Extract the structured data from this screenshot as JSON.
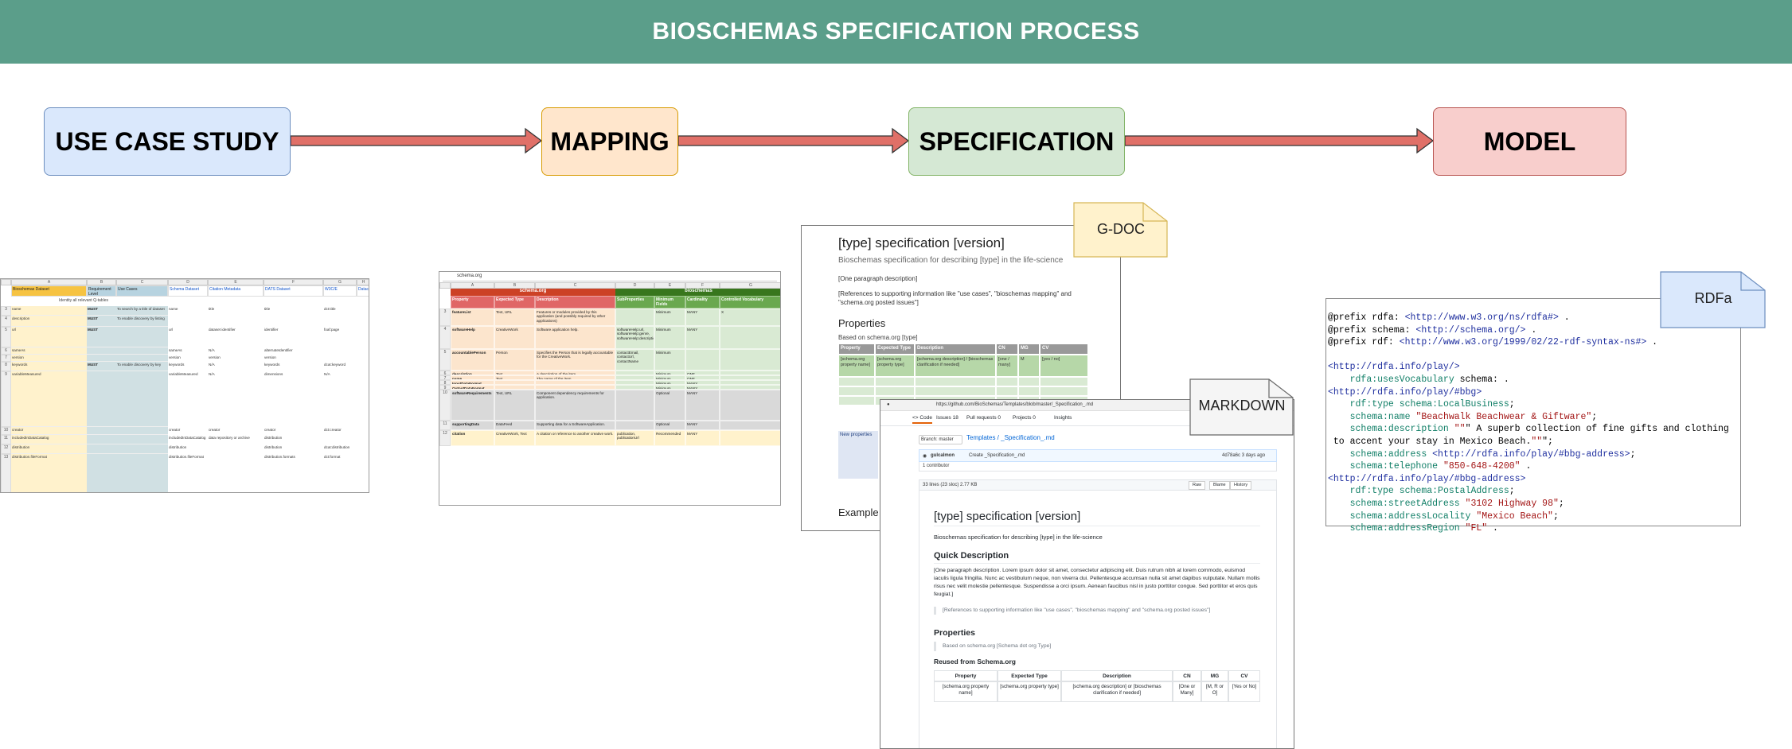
{
  "banner": {
    "title": "BIOSCHEMAS SPECIFICATION PROCESS"
  },
  "stages": [
    {
      "label": "USE CASE STUDY"
    },
    {
      "label": "MAPPING"
    },
    {
      "label": "SPECIFICATION"
    },
    {
      "label": "MODEL"
    }
  ],
  "colors": {
    "banner": "#5b9e8a",
    "arrow_fill": "#e07068",
    "arrow_stroke": "#333333"
  },
  "notes": {
    "gdoc": "G-DOC",
    "markdown": "MARKDOWN",
    "rdfa": "RDFa"
  },
  "gdoc": {
    "title": "[type] specification [version]",
    "subtitle": "Bioschemas specification for describing [type] in the life-science",
    "para1": "[One paragraph description]",
    "para2": "[References to supporting information like \"use cases\", \"bioschemas mapping\" and \"schema.org posted issues\"]",
    "properties_heading": "Properties",
    "based_on": "Based on schema.org [type]",
    "table_headers": [
      "Property",
      "Expected Type",
      "Description",
      "CN",
      "MG",
      "CV"
    ],
    "table_row": [
      "[schema.org property name]",
      "[schema.org property type]",
      "[schema.org description] / [bioschemas clarification if needed]",
      "[one / many]",
      "M",
      "[yes / no]"
    ],
    "new_props": "New properties",
    "example": "Example"
  },
  "github": {
    "url": "https://github.com/BioSchemas/Templates/blob/master/_Specification_.md",
    "tabs": [
      "<> Code",
      "Issues 18",
      "Pull requests 0",
      "Projects 0",
      "Insights"
    ],
    "branch": "Branch: master",
    "breadcrumb": "Templates / _Specification_.md",
    "author": "gulcalmon",
    "commit": "Create _Specification_.md",
    "commit_meta": "4d78a6c 3 days ago",
    "contributors": "1 contributor",
    "file_meta": "33 lines (23 sloc)  2.77 KB",
    "file_buttons": [
      "Raw",
      "Blame",
      "History"
    ],
    "h1": "[type] specification [version]",
    "sub": "Bioschemas specification for describing [type] in the life-science",
    "quick": "Quick Description",
    "desc": "[One paragraph description. Lorem ipsum dolor sit amet, consectetur adipiscing elit. Duis rutrum nibh at lorem commodo, euismod iaculis ligula fringilla. Nunc ac vestibulum neque, non viverra dui. Pellentesque accumsan nulla sit amet dapibus vulputate. Nullam mollis risus nec velit molestie pellentesque. Suspendisse a orci ipsum. Aenean faucibus nisl in justo porttitor congue. Sed porttitor et eros quis feugiat.]",
    "refs": "[References to supporting information like \"use cases\", \"bioschemas mapping\" and \"schema.org posted issues\"]",
    "props": "Properties",
    "based": "Based on schema.org [Schema dot org Type]",
    "reused": "Reused from Schema.org",
    "table_headers": [
      "Property",
      "Expected Type",
      "Description",
      "CN",
      "MG",
      "CV"
    ],
    "table_row": [
      "[schema.org property name]",
      "[schema.org property type]",
      "[schema.org description] or [bioschemas clarification if needed]",
      "[One or Many]",
      "[M, R or O]",
      "[Yes or No]"
    ]
  },
  "rdfa": {
    "lines": [
      "@prefix rdfa: <http://www.w3.org/ns/rdfa#> .",
      "@prefix schema: <http://schema.org/> .",
      "@prefix rdf: <http://www.w3.org/1999/02/22-rdf-syntax-ns#> .",
      "",
      "<http://rdfa.info/play/>",
      "    rdfa:usesVocabulary schema: .",
      "<http://rdfa.info/play/#bbg>",
      "    rdf:type schema:LocalBusiness;",
      "    schema:name \"Beachwalk Beachwear & Giftware\";",
      "    schema:description \"\"\" A superb collection of fine gifts and clothing",
      " to accent your stay in Mexico Beach.\"\"\";",
      "    schema:address <http://rdfa.info/play/#bbg-address>;",
      "    schema:telephone \"850-648-4200\" .",
      "<http://rdfa.info/play/#bbg-address>",
      "    rdf:type schema:PostalAddress;",
      "    schema:streetAddress \"3102 Highway 98\";",
      "    schema:addressLocality \"Mexico Beach\";",
      "    schema:addressRegion \"FL\" ."
    ]
  },
  "mapping_sheet": {
    "search": "schema.org",
    "group_headers": [
      "schema.org",
      "bioschemas"
    ],
    "headers": [
      "Property",
      "Expected Type",
      "Description",
      "SubProperties",
      "Minimum Fields",
      "Cardinality",
      "Controlled Vocabulary"
    ],
    "rows": [
      [
        "featureList",
        "Text, URL",
        "Features or modules provided by this application (and possibly required by other applications)",
        "",
        "Minimum",
        "MANY",
        "X"
      ],
      [
        "softwareHelp",
        "CreativeWork",
        "Software application help.",
        "softwareHelp:url, softwareHelp:genre, softwareHelp:description",
        "Minimum",
        "MANY",
        ""
      ],
      [
        "accountablePerson",
        "Person",
        "Specifies the Person that is legally accountable for the CreativeWork.",
        "contactEmail, contactUrl, contactName",
        "Minimum",
        "",
        ""
      ],
      [
        "description",
        "Text",
        "A description of the item.",
        "",
        "Minimum",
        "ONE",
        ""
      ],
      [
        "name",
        "Text",
        "The name of the item.",
        "",
        "Minimum",
        "ONE",
        ""
      ],
      [
        "InputDataFormat",
        "",
        "",
        "",
        "Minimum",
        "MANY",
        ""
      ],
      [
        "OutputDataFormat",
        "",
        "",
        "",
        "Minimum",
        "MANY",
        ""
      ],
      [
        "softwareRequirements",
        "Text, URL",
        "Component dependency requirements for application.",
        "",
        "Optional",
        "MANY",
        ""
      ],
      [
        "supportingData",
        "DataFeed",
        "Supporting data for a SoftwareApplication.",
        "",
        "Optional",
        "MANY",
        ""
      ],
      [
        "citation",
        "CreativeWork, Text",
        "A citation or reference to another creative work.",
        "publication, publicationUrl",
        "Recommended",
        "MANY",
        ""
      ]
    ]
  },
  "usecase_sheet": {
    "headers": [
      "Bioschemas Dataset",
      "Requirement Level",
      "Use Cases",
      "Schema Dataset",
      "Citation Metadata",
      "DATS Dataset",
      "W3C/E",
      "Datac"
    ],
    "first_row": "Identity all relevant Q-tables",
    "rows": [
      [
        "name",
        "MUST",
        "To search by a title of dataset",
        "name",
        "title",
        "title",
        "dct:title"
      ],
      [
        "description",
        "MUST",
        "To enable discovery by listing"
      ],
      [
        "url",
        "MUST",
        "",
        "url",
        "dataset identifier",
        "identifier",
        "foaf:page"
      ],
      [
        "sameAs",
        "",
        "",
        "sameAs",
        "N/A",
        "alternateIdentifier"
      ],
      [
        "version",
        "",
        "",
        "version",
        "version",
        "version"
      ],
      [
        "keywords",
        "MUST",
        "To enable discovery by key",
        "keywords",
        "N/A",
        "keywords",
        "dcat:keyword"
      ],
      [
        "variableMeasured",
        "",
        "",
        "variableMeasured",
        "N/A",
        "dimensions",
        "N/A"
      ],
      [
        "creator",
        "",
        "",
        "creator",
        "creator",
        "creator",
        "dct:creator"
      ],
      [
        "includedInDataCatalog",
        "",
        "",
        "includedInDataCatalog",
        "data repository or archive",
        "distribution"
      ],
      [
        "distribution",
        "",
        "",
        "distribution",
        "",
        "distribution",
        "dcat:distribution"
      ],
      [
        "distribution.fileFormat",
        "",
        "",
        "distribution.fileFormat",
        "",
        "distribution.formats",
        "dct:format"
      ]
    ]
  }
}
